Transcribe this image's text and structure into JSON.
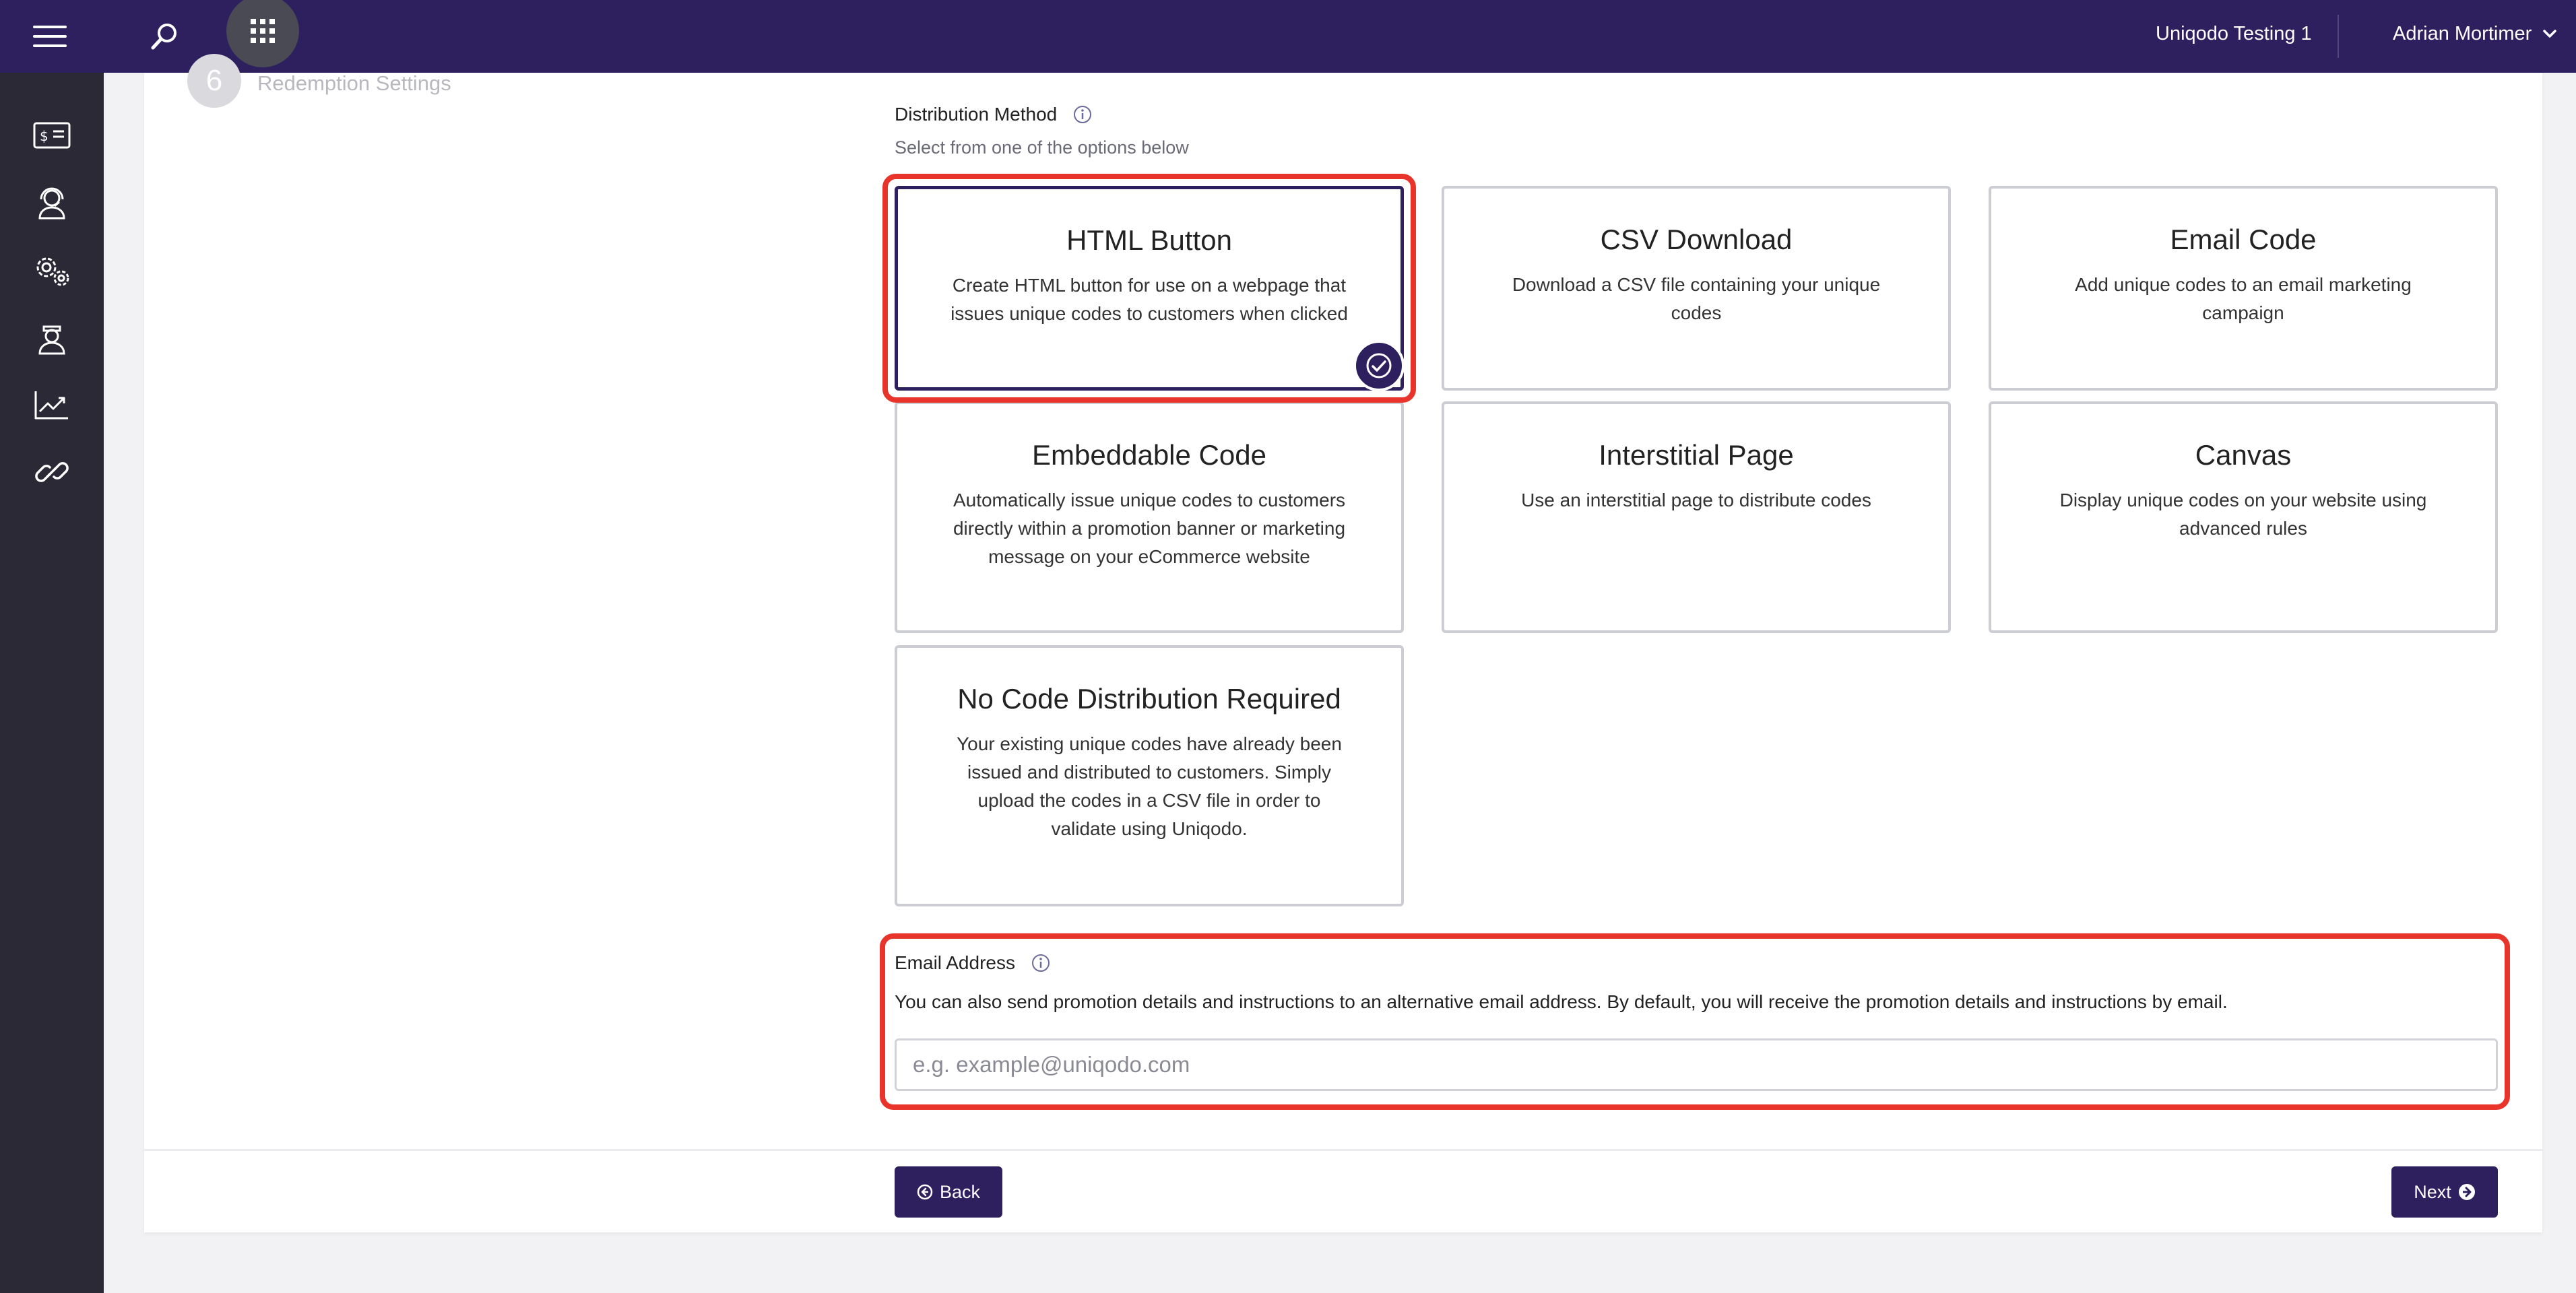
{
  "header": {
    "menu_icon": "hamburger-menu-icon",
    "search_icon": "search-icon",
    "apps_icon": "apps-grid-icon",
    "organization": "Uniqodo Testing 1",
    "user_name": "Adrian Mortimer",
    "user_menu_icon": "chevron-down-icon",
    "bar_color": "#2e1f5e"
  },
  "sidebar": {
    "items": [
      {
        "name": "voucher-icon"
      },
      {
        "name": "support-agent-icon"
      },
      {
        "name": "settings-gears-icon"
      },
      {
        "name": "user-admin-icon"
      },
      {
        "name": "analytics-chart-icon"
      },
      {
        "name": "link-icon"
      }
    ]
  },
  "step": {
    "number": "6",
    "label": "Redemption Settings"
  },
  "distribution": {
    "title": "Distribution Method",
    "subtitle": "Select from one of the options below",
    "selected": "HTML Button",
    "options": [
      {
        "title": "HTML Button",
        "description": "Create HTML button for use on a webpage that issues unique codes to customers when clicked"
      },
      {
        "title": "CSV Download",
        "description": "Download a CSV file containing your unique codes"
      },
      {
        "title": "Email Code",
        "description": "Add unique codes to an email marketing campaign"
      },
      {
        "title": "Embeddable Code",
        "description": "Automatically issue unique codes to customers directly within a promotion banner or marketing message on your eCommerce website"
      },
      {
        "title": "Interstitial Page",
        "description": "Use an interstitial page to distribute codes"
      },
      {
        "title": "Canvas",
        "description": "Display unique codes on your website using advanced rules"
      },
      {
        "title": "No Code Distribution Required",
        "description": "Your existing unique codes have already been issued and distributed to customers. Simply upload the codes in a CSV file in order to validate using Uniqodo."
      }
    ]
  },
  "email": {
    "title": "Email Address",
    "description": "You can also send promotion details and instructions to an alternative email address. By default, you will receive the promotion details and instructions by email.",
    "value": "",
    "placeholder": "e.g. example@uniqodo.com"
  },
  "footer": {
    "back_label": "Back",
    "next_label": "Next"
  },
  "colors": {
    "accent": "#2e1f5e",
    "highlight": "#e8342a"
  }
}
